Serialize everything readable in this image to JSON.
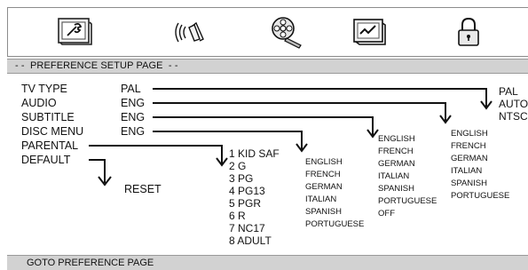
{
  "tabs": [
    {
      "icon": "general-setup-icon"
    },
    {
      "icon": "audio-speaker-icon"
    },
    {
      "icon": "video-film-reel-icon"
    },
    {
      "icon": "preference-screen-icon"
    },
    {
      "icon": "password-lock-icon"
    }
  ],
  "page_title": "- -  PREFERENCE SETUP PAGE  - -",
  "settings": [
    {
      "label": "TV TYPE",
      "value": "PAL"
    },
    {
      "label": "AUDIO",
      "value": "ENG"
    },
    {
      "label": "SUBTITLE",
      "value": "ENG"
    },
    {
      "label": "DISC MENU",
      "value": "ENG"
    },
    {
      "label": "PARENTAL",
      "value": ""
    },
    {
      "label": "DEFAULT",
      "value": ""
    }
  ],
  "default_option": "RESET",
  "tv_type_options": [
    "PAL",
    "AUTO",
    "NTSC"
  ],
  "audio_options": [
    "ENGLISH",
    "FRENCH",
    "GERMAN",
    "ITALIAN",
    "SPANISH",
    "PORTUGUESE"
  ],
  "subtitle_options": [
    "ENGLISH",
    "FRENCH",
    "GERMAN",
    "ITALIAN",
    "SPANISH",
    "PORTUGUESE",
    "OFF"
  ],
  "disc_menu_options": [
    "ENGLISH",
    "FRENCH",
    "GERMAN",
    "ITALIAN",
    "SPANISH",
    "PORTUGUESE"
  ],
  "parental_options": [
    "1 KID SAF",
    "2 G",
    "3 PG",
    "4 PG13",
    "5 PGR",
    "6 R",
    "7 NC17",
    "8 ADULT"
  ],
  "footer_text": "GOTO PREFERENCE PAGE",
  "colors": {
    "bar": "#d2d2d2",
    "text": "#111111",
    "border": "#8c8c8c"
  }
}
